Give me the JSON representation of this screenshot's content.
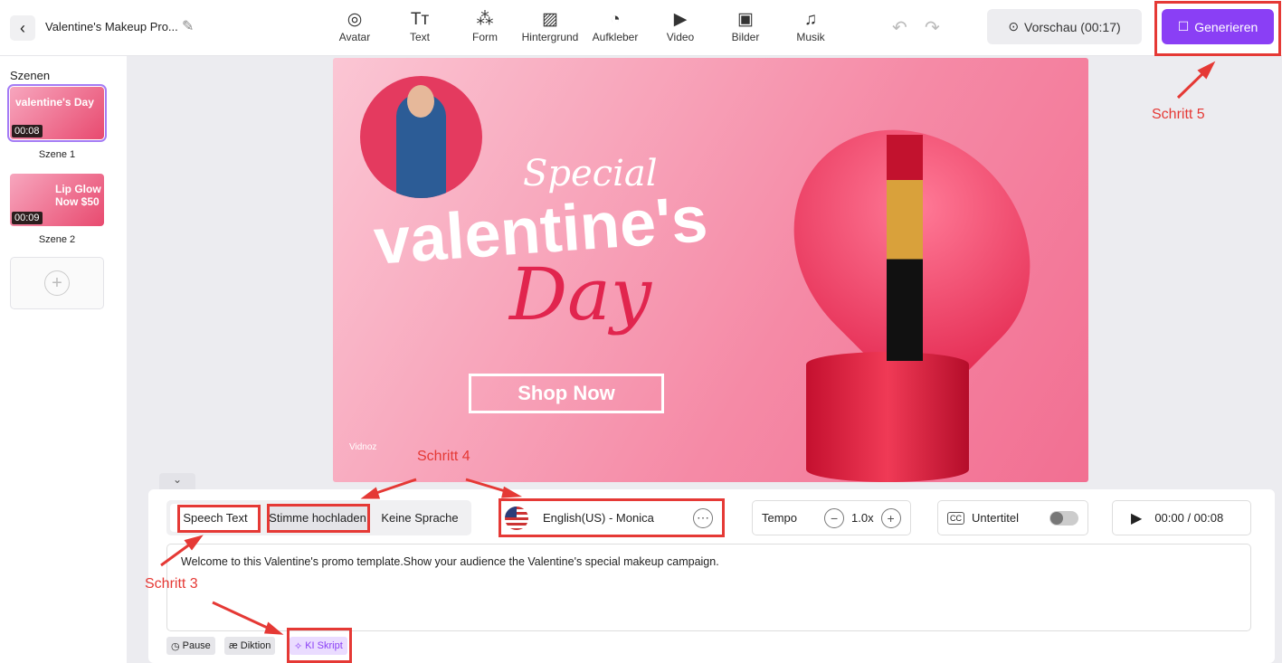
{
  "header": {
    "title": "Valentine's Makeup Pro...",
    "tools": [
      {
        "label": "Avatar",
        "icon": "avatar-icon",
        "glyph": "◎"
      },
      {
        "label": "Text",
        "icon": "text-icon",
        "glyph": "Tт"
      },
      {
        "label": "Form",
        "icon": "shapes-icon",
        "glyph": "⁂"
      },
      {
        "label": "Hintergrund",
        "icon": "background-icon",
        "glyph": "▨"
      },
      {
        "label": "Aufkleber",
        "icon": "sticker-icon",
        "glyph": "◔"
      },
      {
        "label": "Video",
        "icon": "video-icon",
        "glyph": "▶"
      },
      {
        "label": "Bilder",
        "icon": "image-icon",
        "glyph": "▣"
      },
      {
        "label": "Musik",
        "icon": "music-icon",
        "glyph": "♫"
      }
    ],
    "preview": "Vorschau (00:17)",
    "generate": "Generieren"
  },
  "sidebar": {
    "title": "Szenen",
    "scenes": [
      {
        "label": "Szene 1",
        "duration": "00:08",
        "thumb_text": "valentine's Day"
      },
      {
        "label": "Szene 2",
        "duration": "00:09",
        "thumb_text": "Lip Glow Now $50"
      }
    ]
  },
  "canvas": {
    "special": "Special",
    "valentines": "valentine's",
    "day": "Day",
    "shop": "Shop Now",
    "logo": "Vidnoz"
  },
  "panel": {
    "modes": [
      "Speech Text",
      "Stimme hochladen",
      "Keine Sprache"
    ],
    "voice": "English(US) - Monica",
    "tempo_label": "Tempo",
    "tempo": "1.0x",
    "subtitle_label": "Untertitel",
    "time": "00:00 / 00:08",
    "script": "Welcome to this Valentine's promo template.Show your audience the Valentine's special makeup campaign.",
    "chips": [
      "Pause",
      "Diktion",
      "KI Skript"
    ]
  },
  "annotations": [
    "Schritt 3",
    "Schritt 4",
    "Schritt 5"
  ],
  "colors": {
    "accent": "#8a3ff5",
    "annotation": "#e53935"
  }
}
